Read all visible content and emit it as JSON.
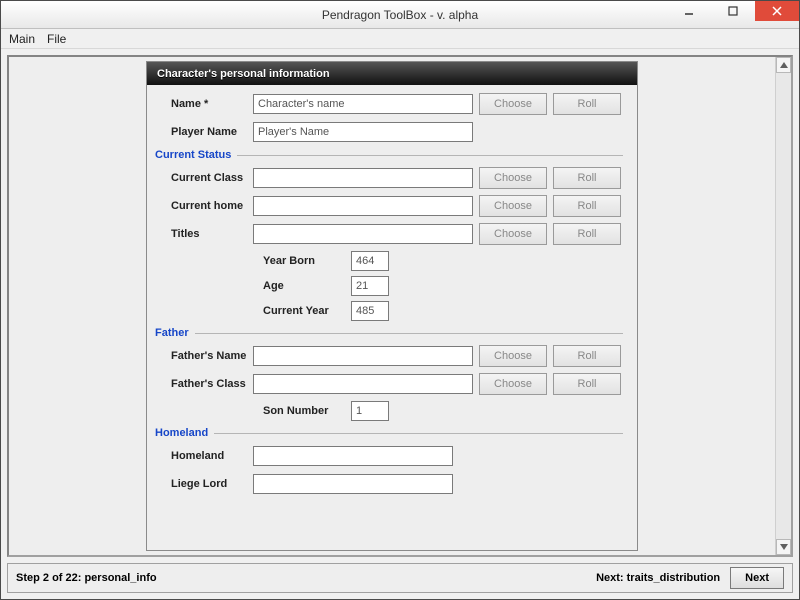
{
  "window": {
    "title": "Pendragon ToolBox - v. alpha"
  },
  "menu": {
    "main": "Main",
    "file": "File"
  },
  "panel": {
    "title": "Character's personal information",
    "name_label": "Name *",
    "name_value": "Character's name",
    "player_label": "Player Name",
    "player_value": "Player's Name",
    "choose": "Choose",
    "roll": "Roll",
    "status_legend": "Current Status",
    "current_class_label": "Current Class",
    "current_class_value": "",
    "current_home_label": "Current home",
    "current_home_value": "",
    "titles_label": "Titles",
    "titles_value": "",
    "year_born_label": "Year Born",
    "year_born_value": "464",
    "age_label": "Age",
    "age_value": "21",
    "current_year_label": "Current Year",
    "current_year_value": "485",
    "father_legend": "Father",
    "father_name_label": "Father's Name",
    "father_name_value": "",
    "father_class_label": "Father's Class",
    "father_class_value": "",
    "son_number_label": "Son Number",
    "son_number_value": "1",
    "homeland_legend": "Homeland",
    "homeland_label": "Homeland",
    "homeland_value": "",
    "liege_label": "Liege Lord",
    "liege_value": ""
  },
  "status": {
    "step": "Step 2 of 22: personal_info",
    "next_label": "Next: traits_distribution",
    "next_btn": "Next"
  }
}
